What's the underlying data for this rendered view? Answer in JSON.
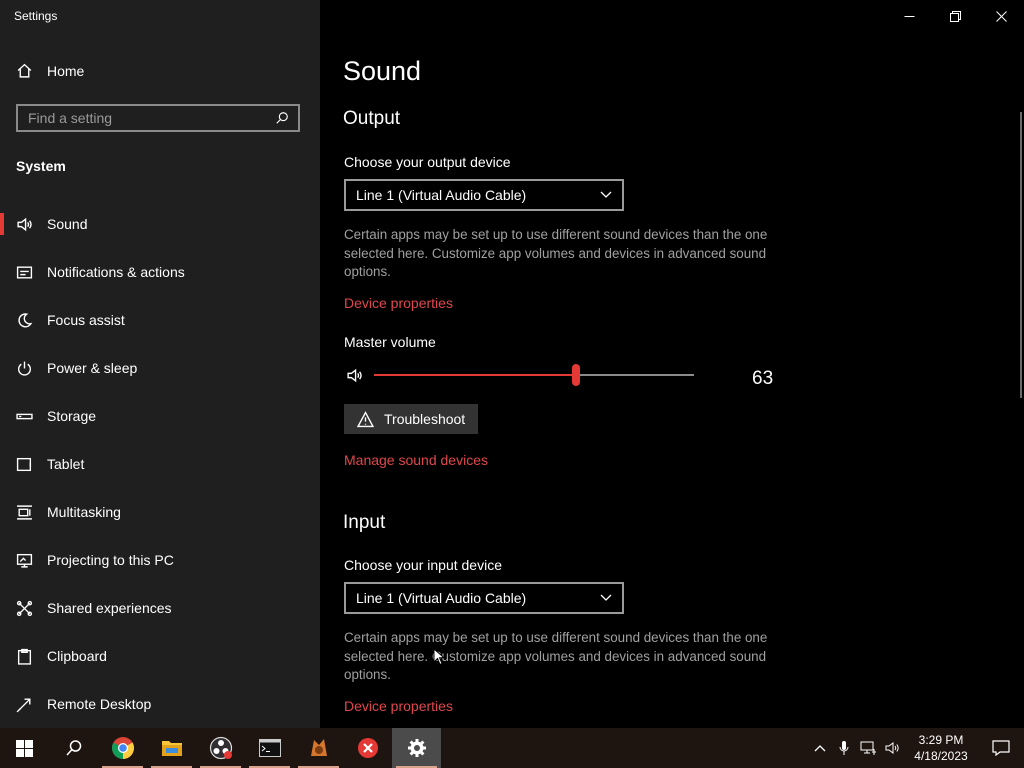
{
  "window": {
    "title": "Settings"
  },
  "sidebar": {
    "home_label": "Home",
    "search_placeholder": "Find a setting",
    "section_label": "System",
    "items": [
      {
        "label": "Sound",
        "icon": "speaker-icon",
        "active": true
      },
      {
        "label": "Notifications & actions",
        "icon": "notification-icon"
      },
      {
        "label": "Focus assist",
        "icon": "moon-icon"
      },
      {
        "label": "Power & sleep",
        "icon": "power-icon"
      },
      {
        "label": "Storage",
        "icon": "storage-icon"
      },
      {
        "label": "Tablet",
        "icon": "tablet-icon"
      },
      {
        "label": "Multitasking",
        "icon": "multitasking-icon"
      },
      {
        "label": "Projecting to this PC",
        "icon": "projector-icon"
      },
      {
        "label": "Shared experiences",
        "icon": "share-icon"
      },
      {
        "label": "Clipboard",
        "icon": "clipboard-icon"
      },
      {
        "label": "Remote Desktop",
        "icon": "remote-desktop-icon"
      }
    ]
  },
  "main": {
    "page_title": "Sound",
    "output": {
      "heading": "Output",
      "choose_label": "Choose your output device",
      "device": "Line 1 (Virtual Audio Cable)",
      "description": "Certain apps may be set up to use different sound devices than the one selected here. Customize app volumes and devices in advanced sound options.",
      "device_properties": "Device properties",
      "master_volume_label": "Master volume",
      "master_volume": 63,
      "master_volume_text": "63",
      "troubleshoot": "Troubleshoot",
      "manage_devices": "Manage sound devices"
    },
    "input": {
      "heading": "Input",
      "choose_label": "Choose your input device",
      "device": "Line 1 (Virtual Audio Cable)",
      "description": "Certain apps may be set up to use different sound devices than the one selected here. Customize app volumes and devices in advanced sound options.",
      "device_properties": "Device properties"
    }
  },
  "taskbar": {
    "apps": [
      "windows-start-icon",
      "search-icon",
      "chrome-icon",
      "file-explorer-icon",
      "obs-icon",
      "terminal-icon",
      "app-icon",
      "x-app-icon",
      "settings-gear-icon"
    ],
    "time": "3:29 PM",
    "date": "4/18/2023"
  },
  "colors": {
    "accent": "#e53935",
    "link": "#e0474c",
    "sidebar_bg": "#1f1f1f",
    "main_bg": "#000000"
  }
}
